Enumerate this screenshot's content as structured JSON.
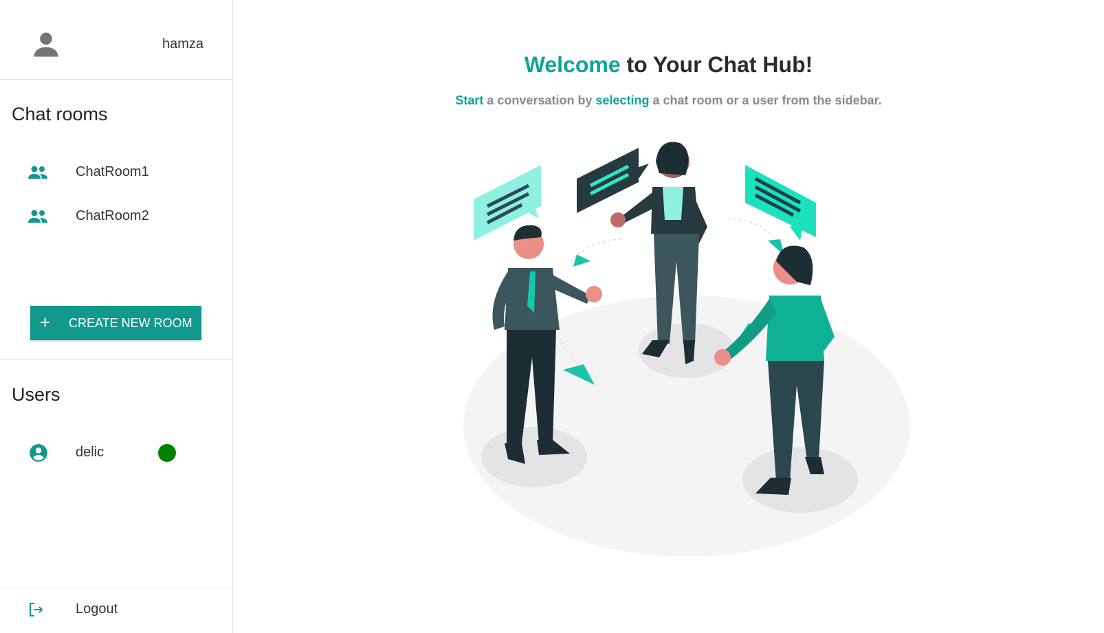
{
  "user": {
    "name": "hamza",
    "avatar_icon": "person-icon"
  },
  "chat_rooms": {
    "title": "Chat rooms",
    "items": [
      {
        "label": "ChatRoom1",
        "icon": "group-icon"
      },
      {
        "label": "ChatRoom2",
        "icon": "group-icon"
      }
    ],
    "create_button_label": "CREATE NEW ROOM",
    "create_button_icon": "plus-icon"
  },
  "users": {
    "title": "Users",
    "items": [
      {
        "name": "delic",
        "icon": "account-circle-icon",
        "status": "online",
        "status_color": "#008000"
      }
    ]
  },
  "logout": {
    "label": "Logout",
    "icon": "logout-icon"
  },
  "welcome": {
    "title_accent": "Welcome",
    "title_rest": " to Your Chat Hub!",
    "subtitle_parts": {
      "start": "Start",
      "mid1": " a conversation by ",
      "selecting": "selecting",
      "mid2": " a chat room or a user from the sidebar."
    }
  },
  "colors": {
    "accent": "#11998e",
    "accent_text": "#11a398",
    "online": "#008000"
  }
}
